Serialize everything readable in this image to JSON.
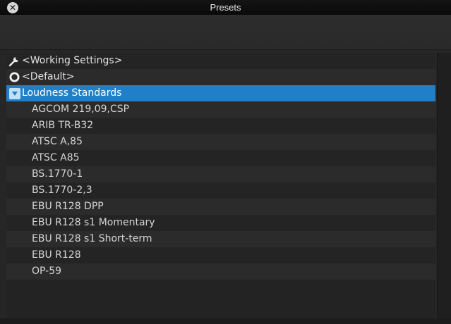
{
  "window": {
    "title": "Presets",
    "close_glyph": "✕"
  },
  "colors": {
    "selection": "#1f7fc9",
    "background": "#232323",
    "row_alt": "#2b2b2b",
    "text": "#e1e1e1"
  },
  "list": {
    "items": [
      {
        "label": "<Working Settings>",
        "icon": "wrench-icon",
        "level": 0
      },
      {
        "label": "<Default>",
        "icon": "circle-icon",
        "level": 0
      },
      {
        "label": "Loudness Standards",
        "icon": "folder-expanded-icon",
        "level": 0,
        "selected": true
      },
      {
        "label": "AGCOM 219,09,CSP",
        "level": 1
      },
      {
        "label": "ARIB TR-B32",
        "level": 1
      },
      {
        "label": "ATSC A,85",
        "level": 1
      },
      {
        "label": "ATSC A85",
        "level": 1
      },
      {
        "label": "BS.1770-1",
        "level": 1
      },
      {
        "label": "BS.1770-2,3",
        "level": 1
      },
      {
        "label": "EBU R128 DPP",
        "level": 1
      },
      {
        "label": "EBU R128 s1 Momentary",
        "level": 1
      },
      {
        "label": "EBU R128 s1 Short-term",
        "level": 1
      },
      {
        "label": "EBU R128",
        "level": 1
      },
      {
        "label": "OP-59",
        "level": 1
      }
    ]
  }
}
